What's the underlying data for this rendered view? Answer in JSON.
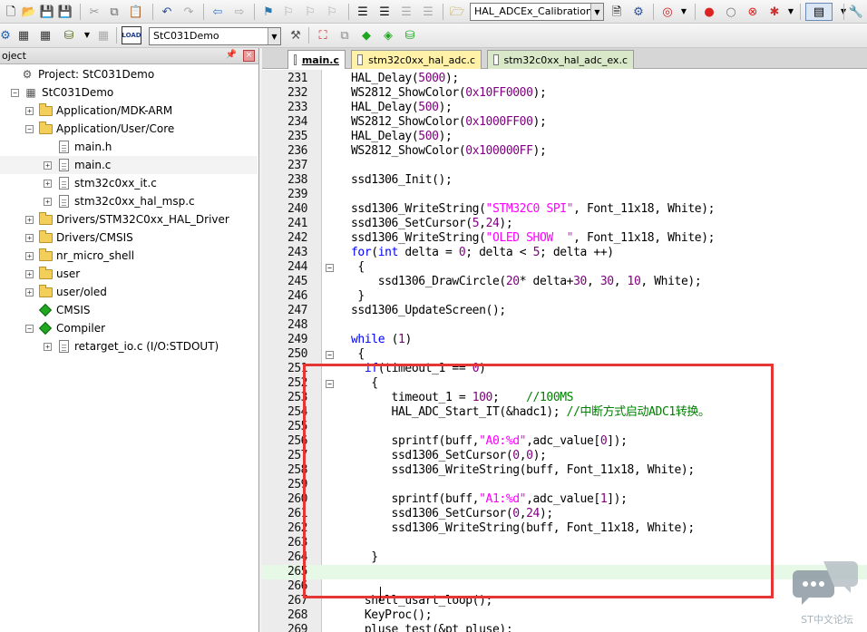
{
  "toolbar1": {
    "target_combo": "HAL_ADCEx_Calibration_S"
  },
  "toolbar2": {
    "target_select": "StC031Demo",
    "load_label": "LOAD"
  },
  "project_panel": {
    "title": "oject",
    "tree": [
      {
        "label": "Project: StC031Demo",
        "icon": "project-icon",
        "indent": 8,
        "expander": "none"
      },
      {
        "label": "StC031Demo",
        "icon": "target-icon",
        "indent": 12,
        "expander": "minus"
      },
      {
        "label": "Application/MDK-ARM",
        "icon": "folder-icon",
        "indent": 28,
        "expander": "plus"
      },
      {
        "label": "Application/User/Core",
        "icon": "folder-icon",
        "indent": 28,
        "expander": "minus"
      },
      {
        "label": "main.h",
        "icon": "file-icon",
        "indent": 48,
        "expander": "none"
      },
      {
        "label": "main.c",
        "icon": "file-icon",
        "indent": 48,
        "expander": "plus",
        "selected": true
      },
      {
        "label": "stm32c0xx_it.c",
        "icon": "file-icon",
        "indent": 48,
        "expander": "plus"
      },
      {
        "label": "stm32c0xx_hal_msp.c",
        "icon": "file-icon",
        "indent": 48,
        "expander": "plus"
      },
      {
        "label": "Drivers/STM32C0xx_HAL_Driver",
        "icon": "folder-icon",
        "indent": 28,
        "expander": "plus"
      },
      {
        "label": "Drivers/CMSIS",
        "icon": "folder-icon",
        "indent": 28,
        "expander": "plus"
      },
      {
        "label": "nr_micro_shell",
        "icon": "folder-icon",
        "indent": 28,
        "expander": "plus"
      },
      {
        "label": "user",
        "icon": "folder-icon",
        "indent": 28,
        "expander": "plus"
      },
      {
        "label": "user/oled",
        "icon": "folder-icon",
        "indent": 28,
        "expander": "plus"
      },
      {
        "label": "CMSIS",
        "icon": "diamond-icon",
        "indent": 28,
        "expander": "none"
      },
      {
        "label": "Compiler",
        "icon": "diamond-icon",
        "indent": 28,
        "expander": "minus"
      },
      {
        "label": "retarget_io.c (I/O:STDOUT)",
        "icon": "file-icon",
        "indent": 48,
        "expander": "plus"
      }
    ]
  },
  "tabs": [
    {
      "label": "main.c",
      "active": true
    },
    {
      "label": "stm32c0xx_hal_adc.c"
    },
    {
      "label": "stm32c0xx_hal_adc_ex.c"
    }
  ],
  "code_lines": [
    {
      "n": "231",
      "code": "HAL_Delay(5000);"
    },
    {
      "n": "232",
      "code": "WS2812_ShowColor(0x10FF0000);"
    },
    {
      "n": "233",
      "code": "HAL_Delay(500);"
    },
    {
      "n": "234",
      "code": "WS2812_ShowColor(0x1000FF00);"
    },
    {
      "n": "235",
      "code": "HAL_Delay(500);"
    },
    {
      "n": "236",
      "code": "WS2812_ShowColor(0x100000FF);"
    },
    {
      "n": "237",
      "code": ""
    },
    {
      "n": "238",
      "code": "ssd1306_Init();"
    },
    {
      "n": "239",
      "code": ""
    },
    {
      "n": "240",
      "code": "ssd1306_WriteString(\"STM32C0 SPI\", Font_11x18, White);"
    },
    {
      "n": "241",
      "code": "ssd1306_SetCursor(5,24);"
    },
    {
      "n": "242",
      "code": "ssd1306_WriteString(\"OLED SHOW  \", Font_11x18, White);"
    },
    {
      "n": "243",
      "code": "for(int delta = 0; delta < 5; delta ++)"
    },
    {
      "n": "244",
      "code": " {",
      "fold": "minus"
    },
    {
      "n": "245",
      "code": "    ssd1306_DrawCircle(20* delta+30, 30, 10, White);"
    },
    {
      "n": "246",
      "code": " }"
    },
    {
      "n": "247",
      "code": "ssd1306_UpdateScreen();"
    },
    {
      "n": "248",
      "code": ""
    },
    {
      "n": "249",
      "code": "while (1)"
    },
    {
      "n": "250",
      "code": " {",
      "fold": "minus"
    },
    {
      "n": "251",
      "code": "  if(timeout_1 == 0)"
    },
    {
      "n": "252",
      "code": "   {",
      "fold": "minus"
    },
    {
      "n": "253",
      "code": "      timeout_1 = 100;    //100MS"
    },
    {
      "n": "254",
      "code": "      HAL_ADC_Start_IT(&hadc1); //中断方式启动ADC1转换。"
    },
    {
      "n": "255",
      "code": ""
    },
    {
      "n": "256",
      "code": "      sprintf(buff,\"A0:%d\",adc_value[0]);"
    },
    {
      "n": "257",
      "code": "      ssd1306_SetCursor(0,0);"
    },
    {
      "n": "258",
      "code": "      ssd1306_WriteString(buff, Font_11x18, White);"
    },
    {
      "n": "259",
      "code": ""
    },
    {
      "n": "260",
      "code": "      sprintf(buff,\"A1:%d\",adc_value[1]);"
    },
    {
      "n": "261",
      "code": "      ssd1306_SetCursor(0,24);"
    },
    {
      "n": "262",
      "code": "      ssd1306_WriteString(buff, Font_11x18, White);"
    },
    {
      "n": "263",
      "code": ""
    },
    {
      "n": "264",
      "code": "   }"
    },
    {
      "n": "265",
      "code": "",
      "current": true
    },
    {
      "n": "266",
      "code": ""
    },
    {
      "n": "267",
      "code": "  shell_usart_loop();"
    },
    {
      "n": "268",
      "code": "  KeyProc();"
    },
    {
      "n": "269",
      "code": "  pluse_test(&pt_pluse);"
    }
  ],
  "watermark": {
    "label": "ST中文论坛"
  }
}
